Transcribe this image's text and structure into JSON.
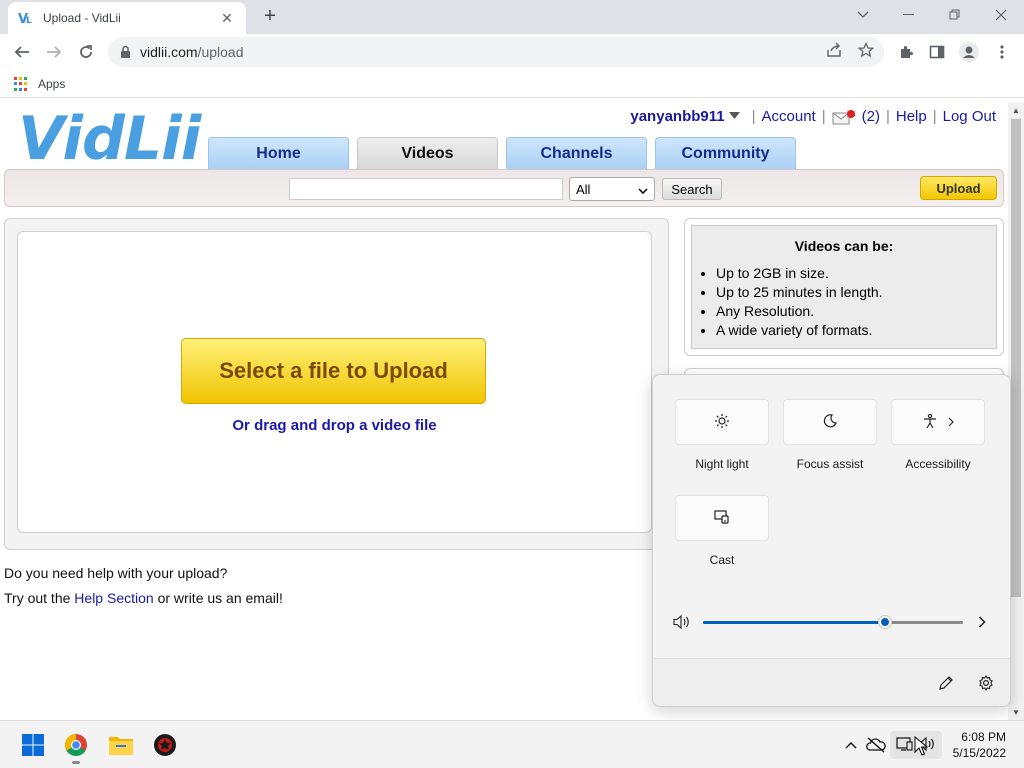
{
  "browser": {
    "tab_title": "Upload - VidLii",
    "tab_close": "✕",
    "new_tab": "+",
    "url_host": "vidlii.com",
    "url_path": "/upload",
    "bookmarks": {
      "apps_label": "Apps"
    }
  },
  "site": {
    "logo_text": "VidLii",
    "user": {
      "username": "yanyanbb911",
      "account": "Account",
      "messages_count": "(2)",
      "help": "Help",
      "logout": "Log Out"
    },
    "nav": [
      {
        "label": "Home"
      },
      {
        "label": "Videos"
      },
      {
        "label": "Channels"
      },
      {
        "label": "Community"
      }
    ],
    "active_nav": "Videos",
    "search": {
      "value": "",
      "filter_selected": "All",
      "search_button": "Search",
      "upload_button": "Upload"
    },
    "upload": {
      "select_button": "Select a file to Upload",
      "drag_text": "Or drag and drop a video file"
    },
    "help": {
      "line1": "Do you need help with your upload?",
      "line2_prefix": "Try out the ",
      "line2_link": "Help Section",
      "line2_suffix": " or write us an email!"
    },
    "info": {
      "title": "Videos can be:",
      "items": [
        "Up to 2GB in size.",
        "Up to 25 minutes in length.",
        "Any Resolution.",
        "A wide variety of formats."
      ]
    }
  },
  "quick_settings": {
    "tiles": [
      {
        "label": "Night light",
        "icon": "night-light-icon"
      },
      {
        "label": "Focus assist",
        "icon": "moon-icon"
      },
      {
        "label": "Accessibility",
        "icon": "accessibility-icon"
      },
      {
        "label": "Cast",
        "icon": "cast-icon"
      }
    ],
    "volume_percent": 70
  },
  "taskbar": {
    "time": "6:08 PM",
    "date": "5/15/2022"
  },
  "colors": {
    "link": "#1a1aa6",
    "accent_blue": "#005fb8",
    "upload_yellow": "#f2c600"
  }
}
